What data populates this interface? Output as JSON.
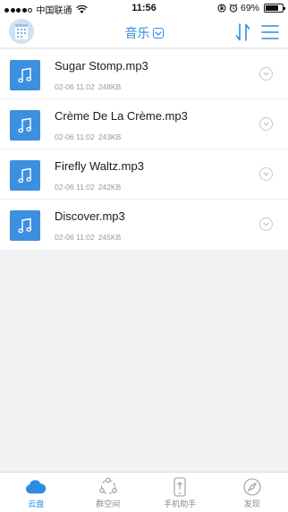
{
  "status_bar": {
    "carrier": "中国联通",
    "time": "11:56",
    "battery": "69%",
    "battery_level": 0.69,
    "signal_bars": 4
  },
  "header": {
    "title": "音乐",
    "sort_icon": "sort-icon",
    "menu_icon": "menu-icon"
  },
  "files": [
    {
      "name": "Sugar Stomp.mp3",
      "date": "02-06 11:02",
      "size": "248KB"
    },
    {
      "name": "Crème De La Crème.mp3",
      "date": "02-06 11:02",
      "size": "243KB"
    },
    {
      "name": "Firefly Waltz.mp3",
      "date": "02-06 11:02",
      "size": "242KB"
    },
    {
      "name": "Discover.mp3",
      "date": "02-06 11:02",
      "size": "245KB"
    }
  ],
  "tabs": [
    {
      "label": "云盘",
      "icon": "cloud-icon",
      "active": true
    },
    {
      "label": "群空间",
      "icon": "group-space-icon",
      "active": false
    },
    {
      "label": "手机助手",
      "icon": "phone-assistant-icon",
      "active": false
    },
    {
      "label": "发现",
      "icon": "compass-icon",
      "active": false
    }
  ],
  "colors": {
    "accent": "#2f8ce3",
    "file_icon_bg": "#3d8fe0",
    "background": "#f1f2f4"
  }
}
